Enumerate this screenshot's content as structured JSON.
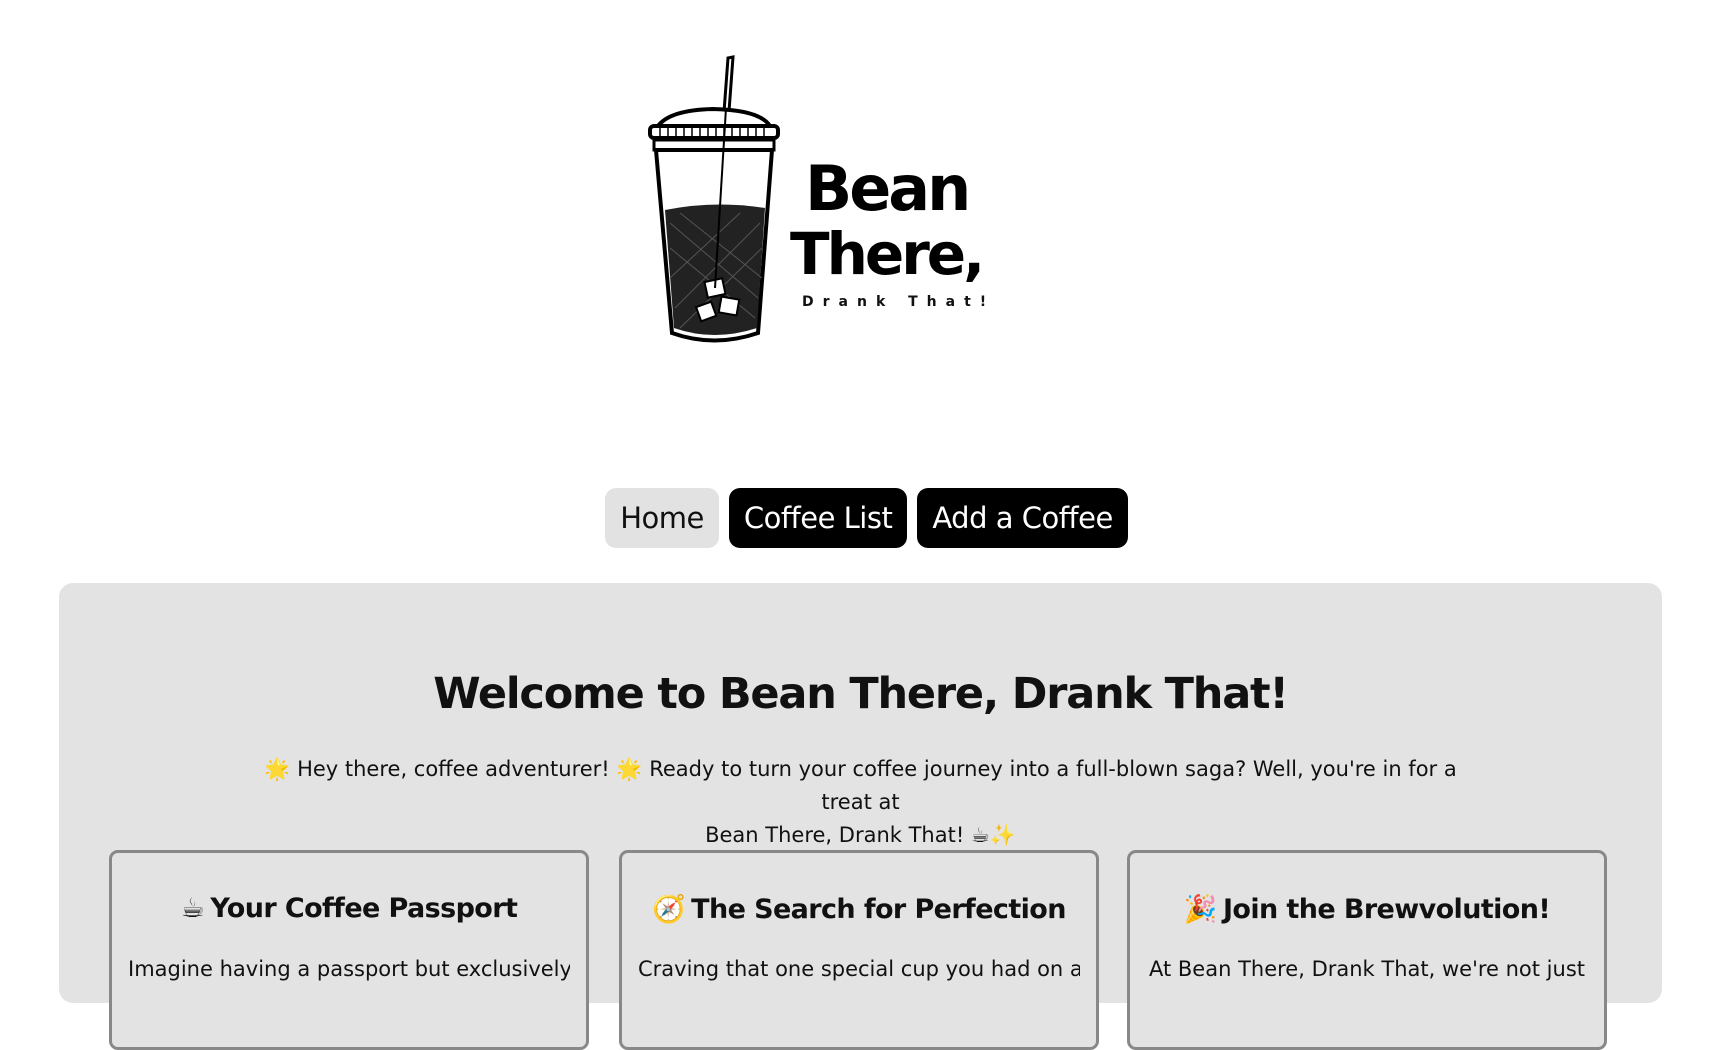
{
  "logo": {
    "word1": "Bean",
    "word2": "There,",
    "tagline": "Drank That!"
  },
  "nav": {
    "items": [
      {
        "label": "Home"
      },
      {
        "label": "Coffee List"
      },
      {
        "label": "Add a Coffee"
      }
    ]
  },
  "main": {
    "heading": "Welcome to Bean There, Drank That!",
    "intro_line1": "🌟 Hey there, coffee adventurer! 🌟 Ready to turn your coffee journey into a full-blown saga? Well, you're in for a treat at",
    "intro_line2": "Bean There, Drank That! ☕✨",
    "cards": [
      {
        "icon": "☕",
        "title": "Your Coffee Passport",
        "body": "Imagine having a passport but exclusively for"
      },
      {
        "icon": "🧭",
        "title": "The Search for Perfection",
        "body": "Craving that one special cup you had on a"
      },
      {
        "icon": "🎉",
        "title": "Join the Brewvolution!",
        "body": "At Bean There, Drank That, we're not just"
      }
    ]
  },
  "colors": {
    "panel_bg": "#e3e3e3",
    "nav_active_bg": "#e2e2e2",
    "nav_dark_bg": "#000000",
    "card_border": "#888888"
  }
}
